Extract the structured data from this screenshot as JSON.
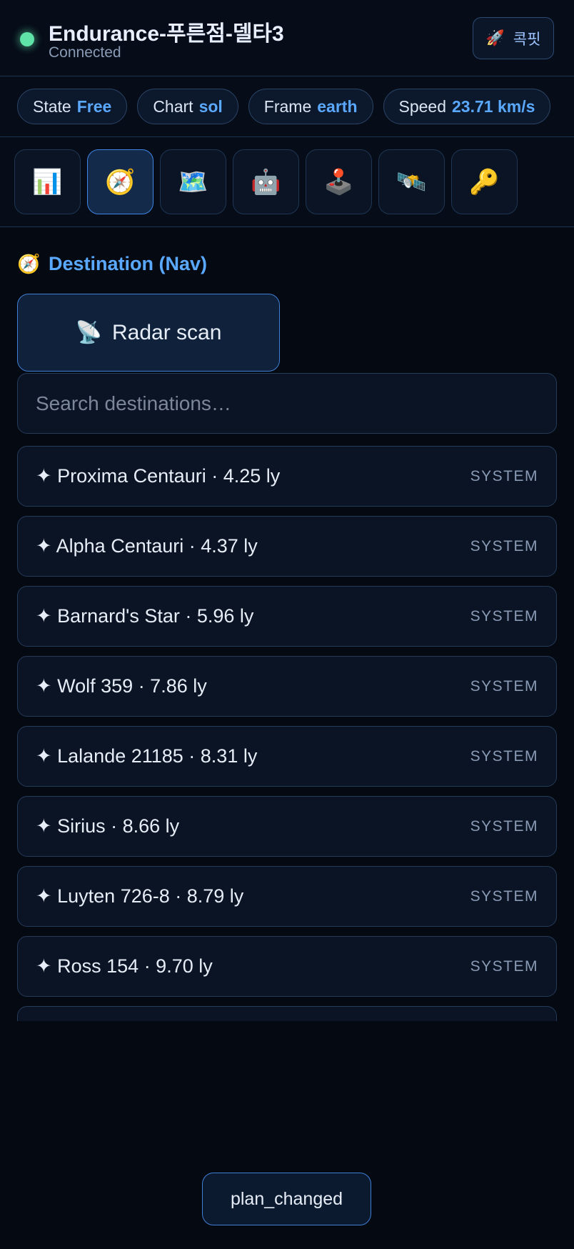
{
  "header": {
    "title": "Endurance-푸른점-델타3",
    "subtitle": "Connected",
    "status_color": "#5fe3a6",
    "cockpit_icon": "🚀",
    "cockpit_label": "콕핏"
  },
  "chips": [
    {
      "label": "State",
      "value": "Free"
    },
    {
      "label": "Chart",
      "value": "sol"
    },
    {
      "label": "Frame",
      "value": "earth"
    },
    {
      "label": "Speed",
      "value": "23.71 km/s"
    }
  ],
  "tabs": [
    {
      "icon": "📊",
      "name": "chart-icon"
    },
    {
      "icon": "🧭",
      "name": "compass-icon",
      "active": true
    },
    {
      "icon": "🗺️",
      "name": "map-icon"
    },
    {
      "icon": "🤖",
      "name": "robot-icon"
    },
    {
      "icon": "🕹️",
      "name": "joystick-icon"
    },
    {
      "icon": "🛰️",
      "name": "satellite-icon"
    },
    {
      "icon": "🔑",
      "name": "key-icon"
    }
  ],
  "section": {
    "icon": "🧭",
    "title": "Destination (Nav)"
  },
  "radar": {
    "icon": "📡",
    "label": "Radar scan"
  },
  "search": {
    "placeholder": "Search destinations…",
    "value": ""
  },
  "destinations": [
    {
      "name": "✦ Proxima Centauri · 4.25 ly",
      "kind": "SYSTEM"
    },
    {
      "name": "✦ Alpha Centauri · 4.37 ly",
      "kind": "SYSTEM"
    },
    {
      "name": "✦ Barnard's Star · 5.96 ly",
      "kind": "SYSTEM"
    },
    {
      "name": "✦ Wolf 359 · 7.86 ly",
      "kind": "SYSTEM"
    },
    {
      "name": "✦ Lalande 21185 · 8.31 ly",
      "kind": "SYSTEM"
    },
    {
      "name": "✦ Sirius · 8.66 ly",
      "kind": "SYSTEM"
    },
    {
      "name": "✦ Luyten 726-8 · 8.79 ly",
      "kind": "SYSTEM"
    },
    {
      "name": "✦ Ross 154 · 9.70 ly",
      "kind": "SYSTEM"
    }
  ],
  "toast": {
    "label": "plan_changed"
  },
  "colors": {
    "accent": "#5aa9ff",
    "background": "#050912",
    "status_connected": "#5fe3a6"
  }
}
